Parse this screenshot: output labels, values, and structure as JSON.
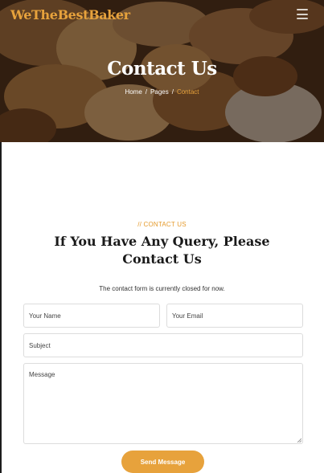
{
  "header": {
    "logo": "WeTheBestBaker",
    "menu_icon": "hamburger-menu-icon"
  },
  "hero": {
    "title": "Contact Us",
    "breadcrumb": {
      "home": "Home",
      "sep": "/",
      "pages": "Pages",
      "current": "Contact"
    },
    "background": "bread-loaves-photo"
  },
  "section": {
    "eyebrow": "// CONTACT US",
    "heading": "If You Have Any Query, Please Contact Us",
    "notice": "The contact form is currently closed for now."
  },
  "form": {
    "name_placeholder": "Your Name",
    "email_placeholder": "Your Email",
    "subject_placeholder": "Subject",
    "message_placeholder": "Message",
    "submit_label": "Send Message"
  },
  "colors": {
    "accent": "#e7a23c",
    "heading": "#1a1a1a",
    "field_border": "#dcdcdc"
  }
}
